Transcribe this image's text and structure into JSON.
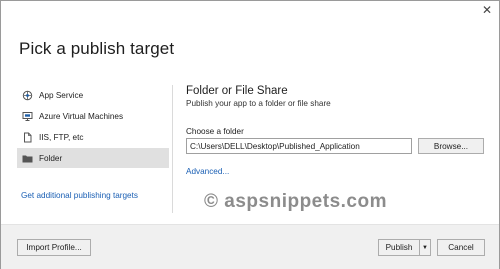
{
  "window": {
    "close_glyph": "✕"
  },
  "title": "Pick a publish target",
  "sidebar": {
    "items": [
      {
        "label": "App Service",
        "icon": "app-service-icon"
      },
      {
        "label": "Azure Virtual Machines",
        "icon": "virtual-machine-icon"
      },
      {
        "label": "IIS, FTP, etc",
        "icon": "document-icon"
      },
      {
        "label": "Folder",
        "icon": "folder-icon",
        "selected": true
      }
    ],
    "get_more_link": "Get additional publishing targets"
  },
  "panel": {
    "title": "Folder or File Share",
    "subtitle": "Publish your app to a folder or file share",
    "choose_label": "Choose a folder",
    "folder_value": "C:\\Users\\DELL\\Desktop\\Published_Application",
    "browse_label": "Browse...",
    "advanced_link": "Advanced..."
  },
  "watermark": "© aspsnippets.com",
  "footer": {
    "import_label": "Import Profile...",
    "publish_label": "Publish",
    "publish_dropdown_glyph": "▼",
    "cancel_label": "Cancel"
  },
  "colors": {
    "link": "#1a5fb4",
    "selected_bg": "#e0e0e0",
    "footer_bg": "#f0f0f0"
  }
}
